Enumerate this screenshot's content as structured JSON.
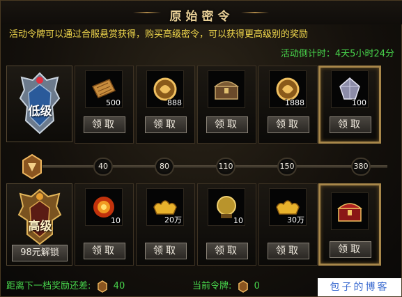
{
  "title": "原始密令",
  "description": "活动令牌可以通过合服悬赏获得，购买高级密令，可以获得更高级别的奖励",
  "countdown": "活动倒计时：4天5小时24分",
  "tiers": {
    "low": {
      "label": "低级"
    },
    "high": {
      "label": "高级",
      "unlock_label": "98元解锁"
    }
  },
  "claim_label": "领取",
  "low_rewards": [
    {
      "icon": "scroll-icon",
      "qty": "500"
    },
    {
      "icon": "gold-medal-icon",
      "qty": "888"
    },
    {
      "icon": "treasure-chest-icon",
      "qty": ""
    },
    {
      "icon": "gold-medal-icon",
      "qty": "1888"
    },
    {
      "icon": "crystal-gem-icon",
      "qty": "100"
    }
  ],
  "high_rewards": [
    {
      "icon": "fire-orb-icon",
      "qty": "10"
    },
    {
      "icon": "gold-ingot-icon",
      "qty": "20万"
    },
    {
      "icon": "golden-orb-icon",
      "qty": "10"
    },
    {
      "icon": "gold-ingot-icon",
      "qty": "30万"
    },
    {
      "icon": "red-chest-icon",
      "qty": ""
    }
  ],
  "thresholds": [
    "40",
    "80",
    "110",
    "150",
    "380"
  ],
  "footer": {
    "next_label": "距离下一档奖励还差:",
    "next_value": "40",
    "current_label": "当前令牌:",
    "current_value": "0"
  },
  "watermark": "包子的博客",
  "colors": {
    "desc": "#f2d94d",
    "green": "#48d64c",
    "gold_frame": "#a8874a"
  }
}
